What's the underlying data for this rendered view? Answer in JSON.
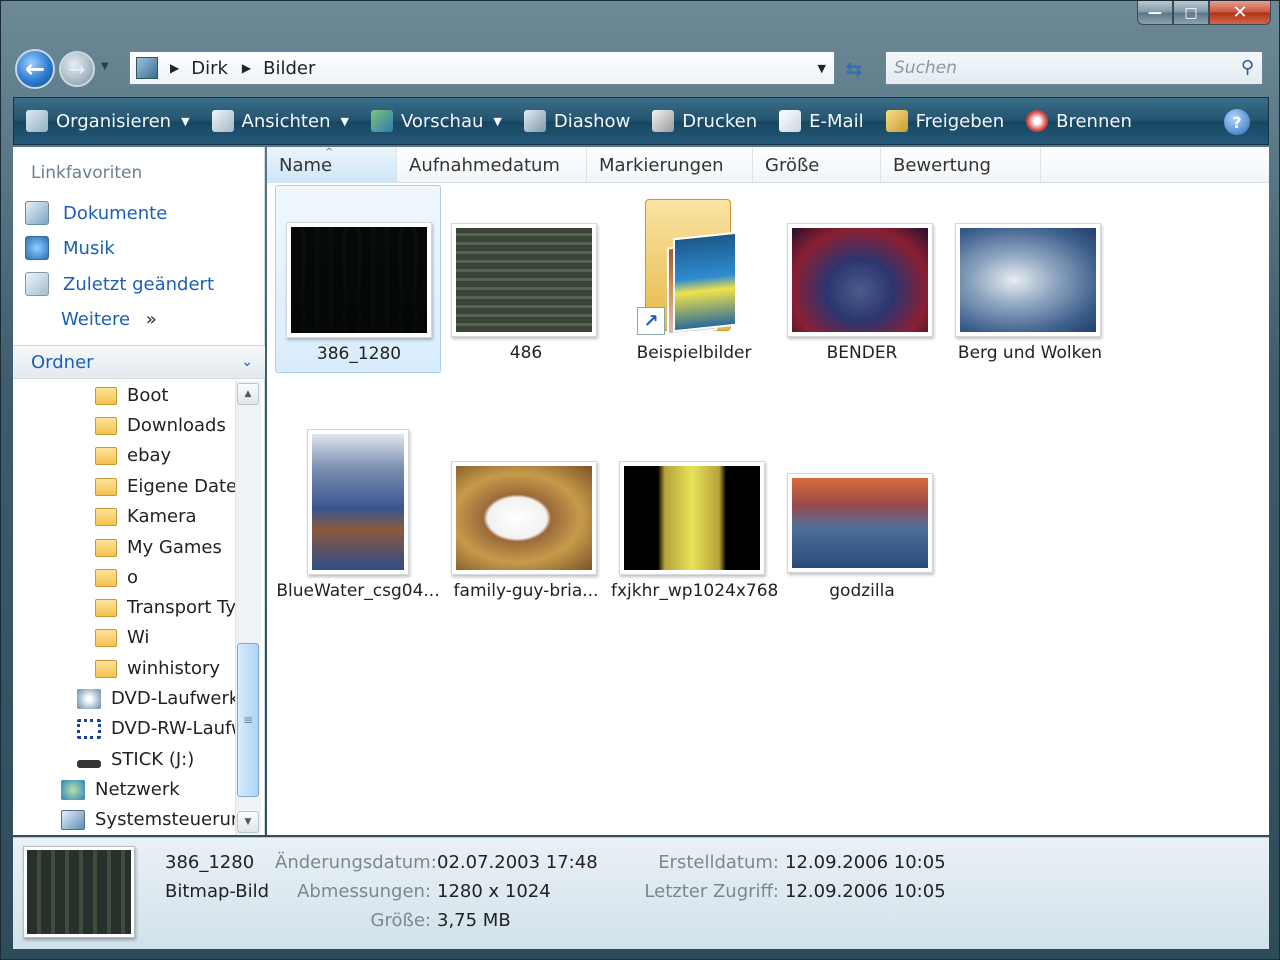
{
  "window": {
    "caption": {
      "minimize": "—",
      "maximize": "□",
      "close": "✕"
    }
  },
  "address": {
    "path": [
      "Dirk",
      "Bilder"
    ],
    "search_placeholder": "Suchen"
  },
  "toolbar": {
    "buttons": [
      "Organisieren",
      "Ansichten",
      "Vorschau",
      "Diashow",
      "Drucken",
      "E-Mail",
      "Freigeben",
      "Brennen"
    ],
    "help": "?"
  },
  "sidebar": {
    "favorites_header": "Linkfavoriten",
    "favorites": [
      "Dokumente",
      "Musik",
      "Zuletzt geändert"
    ],
    "more": "Weitere",
    "more_arrow": "»",
    "folders_header": "Ordner",
    "tree": [
      "Boot",
      "Downloads",
      "ebay",
      "Eigene Dateien",
      "Kamera",
      "My Games",
      "o",
      "Transport Ty",
      "Wi",
      "winhistory",
      "DVD-Laufwerk",
      "DVD-RW-Laufw",
      "STICK (J:)",
      "Netzwerk",
      "Systemsteuerung"
    ]
  },
  "columns": [
    "Name",
    "Aufnahmedatum",
    "Markierungen",
    "Größe",
    "Bewertung"
  ],
  "files": [
    {
      "name": "386_1280",
      "selected": true
    },
    {
      "name": "486"
    },
    {
      "name": "Beispielbilder",
      "type": "folder-shortcut"
    },
    {
      "name": "BENDER"
    },
    {
      "name": "Berg und Wolken"
    },
    {
      "name": "BlueWater_csg04..."
    },
    {
      "name": "family-guy-bria..."
    },
    {
      "name": "fxjkhr_wp1024x768"
    },
    {
      "name": "godzilla"
    }
  ],
  "details": {
    "name": "386_1280",
    "type": "Bitmap-Bild",
    "modified_label": "Änderungsdatum:",
    "modified_value": "02.07.2003 17:48",
    "dimensions_label": "Abmessungen:",
    "dimensions_value": "1280 x 1024",
    "size_label": "Größe:",
    "size_value": "3,75 MB",
    "created_label": "Erstelldatum:",
    "created_value": "12.09.2006 10:05",
    "accessed_label": "Letzter Zugriff:",
    "accessed_value": "12.09.2006 10:05"
  }
}
